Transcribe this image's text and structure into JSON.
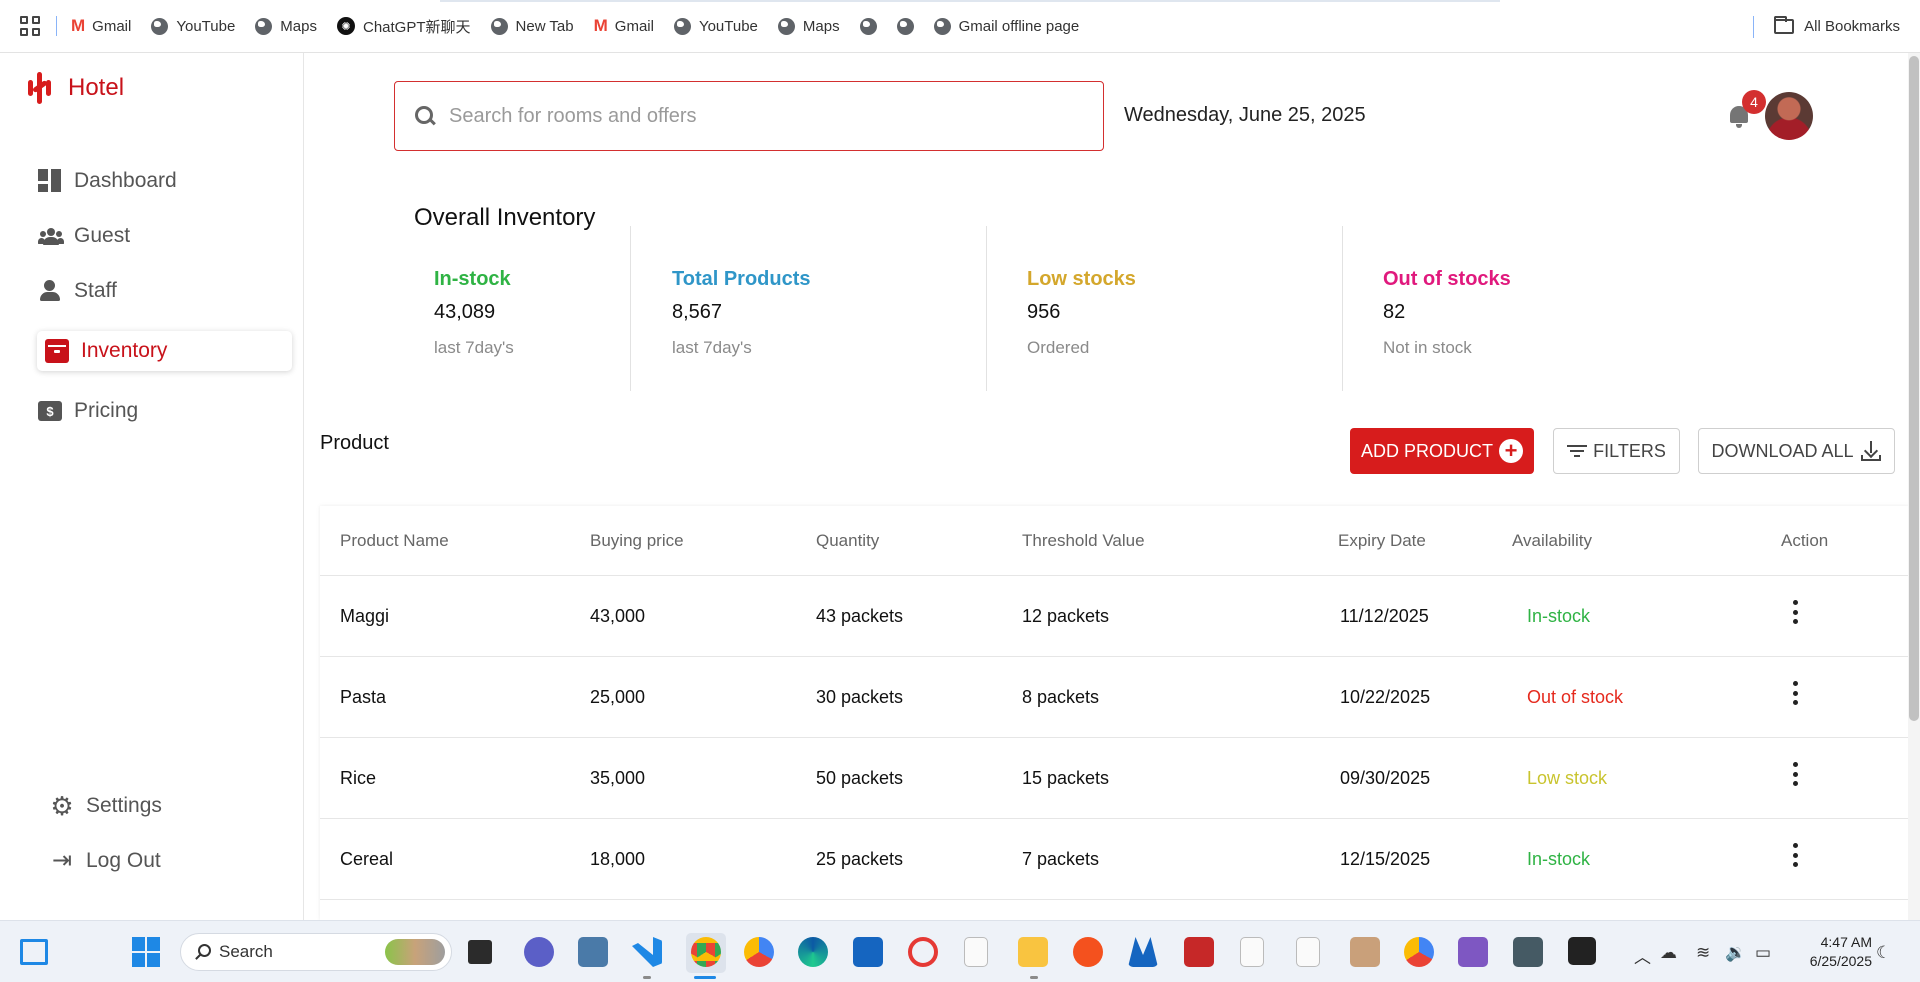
{
  "bookmarks": {
    "items": [
      {
        "label": "Gmail",
        "icon": "gmail-icon"
      },
      {
        "label": "YouTube",
        "icon": "globe-icon"
      },
      {
        "label": "Maps",
        "icon": "globe-icon"
      },
      {
        "label": "ChatGPT新聊天",
        "icon": "chatgpt-icon"
      },
      {
        "label": "New Tab",
        "icon": "globe-icon"
      },
      {
        "label": "Gmail",
        "icon": "gmail-icon"
      },
      {
        "label": "YouTube",
        "icon": "globe-icon"
      },
      {
        "label": "Maps",
        "icon": "globe-icon"
      },
      {
        "label": "",
        "icon": "globe-icon"
      },
      {
        "label": "",
        "icon": "globe-icon"
      },
      {
        "label": "Gmail offline page",
        "icon": "globe-icon"
      }
    ],
    "all_bookmarks": "All Bookmarks"
  },
  "app": {
    "name": "Hotel",
    "brand_color": "#c8121a"
  },
  "sidebar": {
    "items": [
      {
        "label": "Dashboard"
      },
      {
        "label": "Guest"
      },
      {
        "label": "Staff"
      },
      {
        "label": "Inventory"
      },
      {
        "label": "Pricing"
      }
    ],
    "active": "Inventory",
    "settings_label": "Settings",
    "logout_label": "Log Out",
    "pricing_icon_text": "$"
  },
  "header": {
    "search_placeholder": "Search for rooms and offers",
    "date": "Wednesday, June 25, 2025",
    "notification_count": "4"
  },
  "overall": {
    "title": "Overall Inventory",
    "stats": [
      {
        "label": "In-stock",
        "value": "43,089",
        "sub": "last 7day's",
        "color": "#2fb344"
      },
      {
        "label": "Total Products",
        "value": "8,567",
        "sub": "last 7day's",
        "color": "#2f96c8"
      },
      {
        "label": "Low stocks",
        "value": "956",
        "sub": "Ordered",
        "color": "#d4a72c"
      },
      {
        "label": "Out of stocks",
        "value": "82",
        "sub": "Not in stock",
        "color": "#e0197d"
      }
    ]
  },
  "products": {
    "title": "Product",
    "add_label": "ADD PRODUCT",
    "filters_label": "FILTERS",
    "download_label": "DOWNLOAD ALL",
    "columns": [
      "Product Name",
      "Buying price",
      "Quantity",
      "Threshold Value",
      "Expiry Date",
      "Availability",
      "Action"
    ],
    "rows": [
      {
        "name": "Maggi",
        "price": "43,000",
        "quantity": "43 packets",
        "threshold": "12 packets",
        "expiry": "11/12/2025",
        "availability": "In-stock",
        "availability_color": "#2fb344"
      },
      {
        "name": "Pasta",
        "price": "25,000",
        "quantity": "30 packets",
        "threshold": "8 packets",
        "expiry": "10/22/2025",
        "availability": "Out of stock",
        "availability_color": "#e52a1e"
      },
      {
        "name": "Rice",
        "price": "35,000",
        "quantity": "50 packets",
        "threshold": "15 packets",
        "expiry": "09/30/2025",
        "availability": "Low stock",
        "availability_color": "#c9c42e"
      },
      {
        "name": "Cereal",
        "price": "18,000",
        "quantity": "25 packets",
        "threshold": "7 packets",
        "expiry": "12/15/2025",
        "availability": "In-stock",
        "availability_color": "#2fb344"
      }
    ]
  },
  "taskbar": {
    "search_label": "Search",
    "time": "4:47 AM",
    "date": "6/25/2025"
  }
}
